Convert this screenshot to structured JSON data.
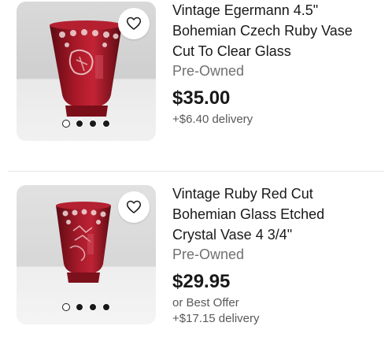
{
  "listings": [
    {
      "title": "Vintage Egermann  4.5\"\nBohemian Czech Ruby Vase\nCut To Clear Glass",
      "condition": "Pre-Owned",
      "price": "$35.00",
      "offer": "",
      "delivery": "+$6.40 delivery",
      "image_dots": {
        "count": 4,
        "active_index": 0
      },
      "favorite_icon": "heart-outline-icon"
    },
    {
      "title": "Vintage Ruby Red Cut\nBohemian Glass Etched\nCrystal Vase 4 3/4\"",
      "condition": "Pre-Owned",
      "price": "$29.95",
      "offer": "or Best Offer",
      "delivery": "+$17.15 delivery",
      "image_dots": {
        "count": 4,
        "active_index": 0
      },
      "favorite_icon": "heart-outline-icon"
    }
  ],
  "colors": {
    "text": "#191919",
    "secondary_text": "#707070",
    "ruby_glass": "#8e1420",
    "divider": "#e5e5e5"
  }
}
